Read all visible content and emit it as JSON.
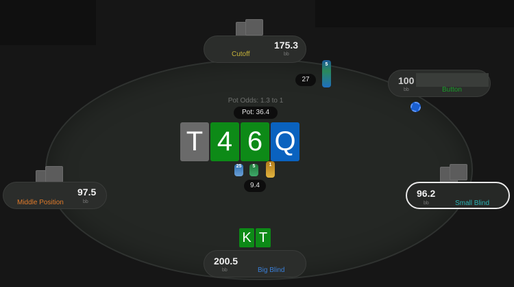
{
  "pot": {
    "odds_text": "Pot Odds: 1.3 to 1",
    "pot_text": "Pot: 36.4"
  },
  "board": {
    "cards": [
      "T",
      "4",
      "6",
      "Q"
    ],
    "colors": [
      "#6a6a6a",
      "#0d8a17",
      "#0d8a17",
      "#0a62bf"
    ]
  },
  "hero": {
    "cards": [
      "K",
      "T"
    ],
    "color": "#0d8a17"
  },
  "bets": {
    "cutoff": "27",
    "center": "9.4"
  },
  "chip_labels": {
    "cutoff_stack": "5",
    "center_left": "25",
    "center_mid": "5",
    "center_right": "1"
  },
  "seats": {
    "cutoff": {
      "stack": "175.3",
      "unit": "bb",
      "position": "Cutoff",
      "position_color": "#c7b43a"
    },
    "button": {
      "stack": "100",
      "unit": "bb",
      "position": "Button",
      "position_color": "#1a9c2a"
    },
    "middle": {
      "stack": "97.5",
      "unit": "bb",
      "position": "Middle Position",
      "position_color": "#e07a2a"
    },
    "small_blind": {
      "stack": "96.2",
      "unit": "bb",
      "position": "Small Blind",
      "position_color": "#2bb3b5"
    },
    "big_blind": {
      "stack": "200.5",
      "unit": "bb",
      "position": "Big Blind",
      "position_color": "#3a7fd8"
    }
  },
  "icons": [
    "dealer-button-chip-icon",
    "chip-stack-icon",
    "card-back-icon"
  ]
}
